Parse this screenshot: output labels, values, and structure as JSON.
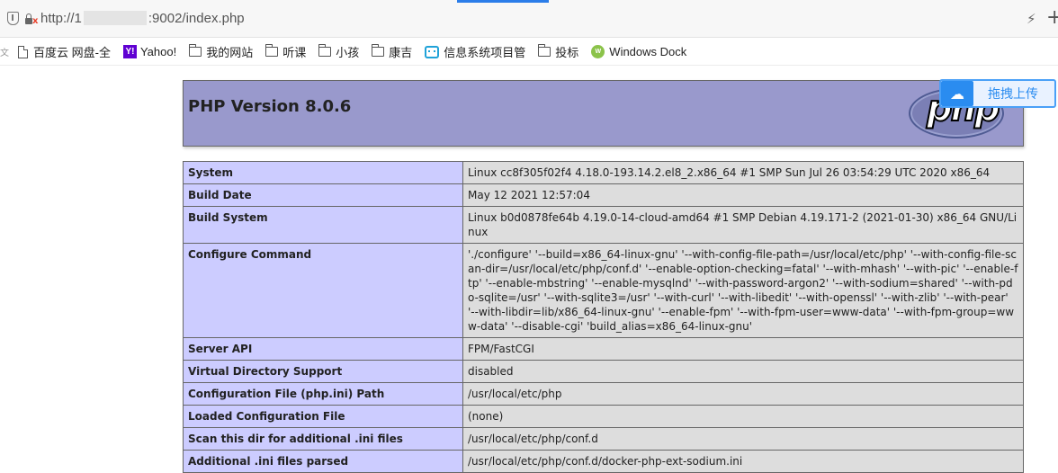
{
  "browser": {
    "url_prefix": "http://1",
    "url_suffix": ":9002/index.php"
  },
  "bookmarks": [
    {
      "label": "百度云 网盘-全",
      "icon": "doc-icon"
    },
    {
      "label": "Yahoo!",
      "icon": "yahoo-icon"
    },
    {
      "label": "我的网站",
      "icon": "folder-icon"
    },
    {
      "label": "听课",
      "icon": "folder-icon"
    },
    {
      "label": "小孩",
      "icon": "folder-icon"
    },
    {
      "label": "康吉",
      "icon": "folder-icon"
    },
    {
      "label": "信息系统项目管",
      "icon": "bilibili-icon"
    },
    {
      "label": "投标",
      "icon": "folder-icon"
    },
    {
      "label": "Windows Dock",
      "icon": "windows-dock-icon"
    }
  ],
  "upload": {
    "label": "拖拽上传",
    "icon": "cloud-upload-icon"
  },
  "php": {
    "title": "PHP Version 8.0.6",
    "logo_text": "php",
    "rows": [
      {
        "key": "System",
        "value": "Linux cc8f305f02f4 4.18.0-193.14.2.el8_2.x86_64 #1 SMP Sun Jul 26 03:54:29 UTC 2020 x86_64"
      },
      {
        "key": "Build Date",
        "value": "May 12 2021 12:57:04"
      },
      {
        "key": "Build System",
        "value": "Linux b0d0878fe64b 4.19.0-14-cloud-amd64 #1 SMP Debian 4.19.171-2 (2021-01-30) x86_64 GNU/Linux"
      },
      {
        "key": "Configure Command",
        "value": "'./configure' '--build=x86_64-linux-gnu' '--with-config-file-path=/usr/local/etc/php' '--with-config-file-scan-dir=/usr/local/etc/php/conf.d' '--enable-option-checking=fatal' '--with-mhash' '--with-pic' '--enable-ftp' '--enable-mbstring' '--enable-mysqlnd' '--with-password-argon2' '--with-sodium=shared' '--with-pdo-sqlite=/usr' '--with-sqlite3=/usr' '--with-curl' '--with-libedit' '--with-openssl' '--with-zlib' '--with-pear' '--with-libdir=lib/x86_64-linux-gnu' '--enable-fpm' '--with-fpm-user=www-data' '--with-fpm-group=www-data' '--disable-cgi' 'build_alias=x86_64-linux-gnu'"
      },
      {
        "key": "Server API",
        "value": "FPM/FastCGI"
      },
      {
        "key": "Virtual Directory Support",
        "value": "disabled"
      },
      {
        "key": "Configuration File (php.ini) Path",
        "value": "/usr/local/etc/php"
      },
      {
        "key": "Loaded Configuration File",
        "value": "(none)"
      },
      {
        "key": "Scan this dir for additional .ini files",
        "value": "/usr/local/etc/php/conf.d"
      },
      {
        "key": "Additional .ini files parsed",
        "value": "/usr/local/etc/php/conf.d/docker-php-ext-sodium.ini"
      }
    ]
  }
}
